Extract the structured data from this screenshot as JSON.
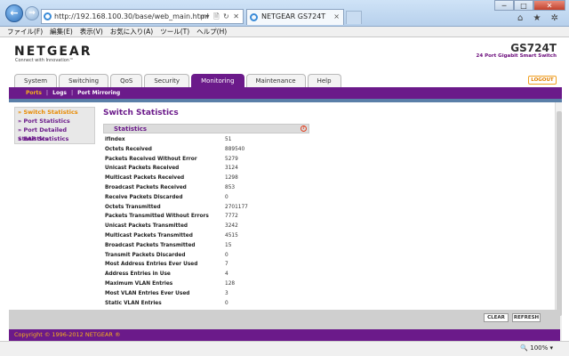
{
  "browser": {
    "url": "http://192.168.100.30/base/web_main.html",
    "url_tools": "ρ▾ 🗎 ↻ ✕",
    "tab_title": "NETGEAR GS724T",
    "tab_close": "×",
    "window_controls": [
      "─",
      "□",
      "✕"
    ],
    "right_icons": "⌂ ★ ✲",
    "menu": [
      "ファイル(F)",
      "編集(E)",
      "表示(V)",
      "お気に入り(A)",
      "ツール(T)",
      "ヘルプ(H)"
    ],
    "zoom": "🔍 100% ▾"
  },
  "header": {
    "logo": "NETGEAR",
    "logo_sub": "Connect with Innovation™",
    "model": "GS724T",
    "model_sub": "24 Port Gigabit Smart Switch",
    "logout": "LOGOUT"
  },
  "tabs": [
    "System",
    "Switching",
    "QoS",
    "Security",
    "Monitoring",
    "Maintenance",
    "Help"
  ],
  "active_tab": "Monitoring",
  "subnav": [
    "Ports",
    "Logs",
    "Port Mirroring"
  ],
  "sidebar": [
    "» Switch Statistics",
    "» Port Statistics",
    "» Port Detailed Statistics",
    "» EAP Statistics"
  ],
  "content": {
    "title": "Switch Statistics",
    "panel_title": "Statistics",
    "help": "?"
  },
  "stats": [
    {
      "k": "ifIndex",
      "v": "51"
    },
    {
      "k": "Octets Received",
      "v": "889540"
    },
    {
      "k": "Packets Received Without Error",
      "v": "5279"
    },
    {
      "k": "Unicast Packets Received",
      "v": "3124"
    },
    {
      "k": "Multicast Packets Received",
      "v": "1298"
    },
    {
      "k": "Broadcast Packets Received",
      "v": "853"
    },
    {
      "k": "Receive Packets Discarded",
      "v": "0"
    },
    {
      "k": "Octets Transmitted",
      "v": "2701177"
    },
    {
      "k": "Packets Transmitted Without Errors",
      "v": "7772"
    },
    {
      "k": "Unicast Packets Transmitted",
      "v": "3242"
    },
    {
      "k": "Multicast Packets Transmitted",
      "v": "4515"
    },
    {
      "k": "Broadcast Packets Transmitted",
      "v": "15"
    },
    {
      "k": "Transmit Packets Discarded",
      "v": "0"
    },
    {
      "k": "Most Address Entries Ever Used",
      "v": "7"
    },
    {
      "k": "Address Entries in Use",
      "v": "4"
    },
    {
      "k": "Maximum VLAN Entries",
      "v": "128"
    },
    {
      "k": "Most VLAN Entries Ever Used",
      "v": "3"
    },
    {
      "k": "Static VLAN Entries",
      "v": "0"
    }
  ],
  "buttons": {
    "clear": "CLEAR",
    "refresh": "REFRESH"
  },
  "footer": "Copyright © 1996-2012 NETGEAR ®",
  "colors": {
    "brand_purple": "#6b1a8a",
    "accent_orange": "#f7b21a"
  }
}
